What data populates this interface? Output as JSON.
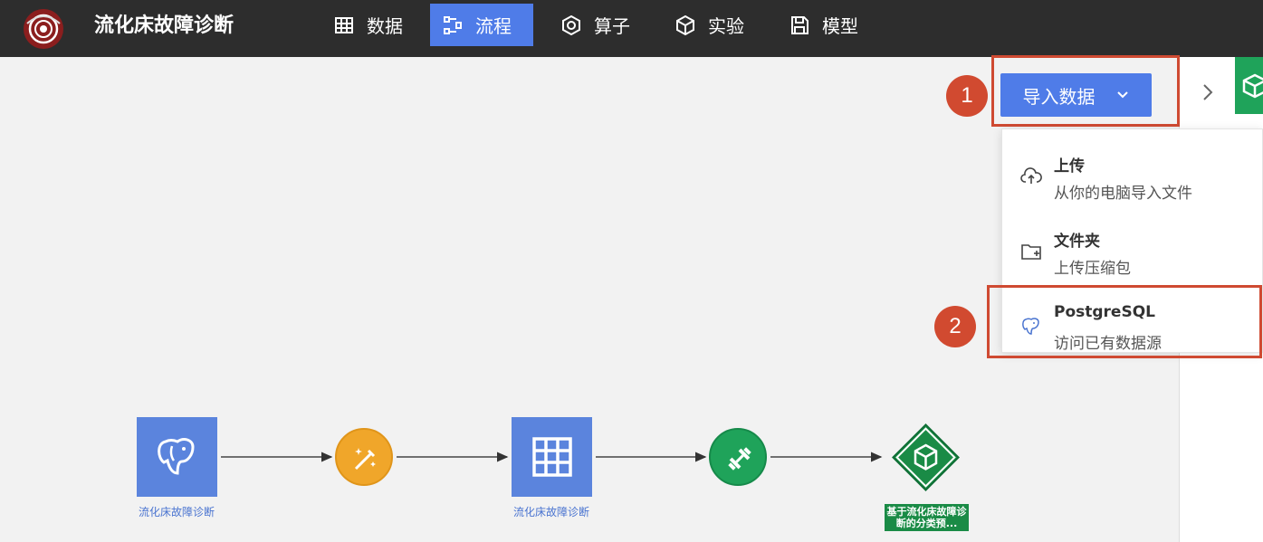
{
  "app": {
    "title": "流化床故障诊断"
  },
  "nav": [
    {
      "label": "数据",
      "icon": "table-icon",
      "active": false
    },
    {
      "label": "流程",
      "icon": "workflow-icon",
      "active": true
    },
    {
      "label": "算子",
      "icon": "operator-icon",
      "active": false
    },
    {
      "label": "实验",
      "icon": "cube-icon",
      "active": false
    },
    {
      "label": "模型",
      "icon": "save-icon",
      "active": false
    }
  ],
  "import": {
    "label": "导入数据",
    "icon": "chevron-down-icon"
  },
  "annotations": {
    "step1": "1",
    "step2": "2"
  },
  "dropdown": {
    "items": [
      {
        "title": "上传",
        "subtitle": "从你的电脑导入文件",
        "icon": "cloud-upload-icon"
      },
      {
        "title": "文件夹",
        "subtitle": "上传压缩包",
        "icon": "folder-add-icon"
      },
      {
        "title": "PostgreSQL",
        "subtitle": "访问已有数据源",
        "icon": "postgresql-icon"
      }
    ]
  },
  "flow": {
    "nodes": [
      {
        "label": "流化床故障诊断",
        "icon": "postgresql-icon"
      },
      {
        "label": "",
        "icon": "magic-wand-icon"
      },
      {
        "label": "流化床故障诊断",
        "icon": "table-icon"
      },
      {
        "label": "",
        "icon": "dumbbell-icon"
      },
      {
        "label": "基于流化床故障诊断的分类预...",
        "icon": "cube-icon"
      }
    ]
  },
  "colors": {
    "header": "#2d2d2d",
    "accent": "#4f7ce8",
    "highlight": "#cf4a32",
    "orange": "#f0a62a",
    "green": "#1fa35a",
    "node_blue": "#5b84dd"
  }
}
